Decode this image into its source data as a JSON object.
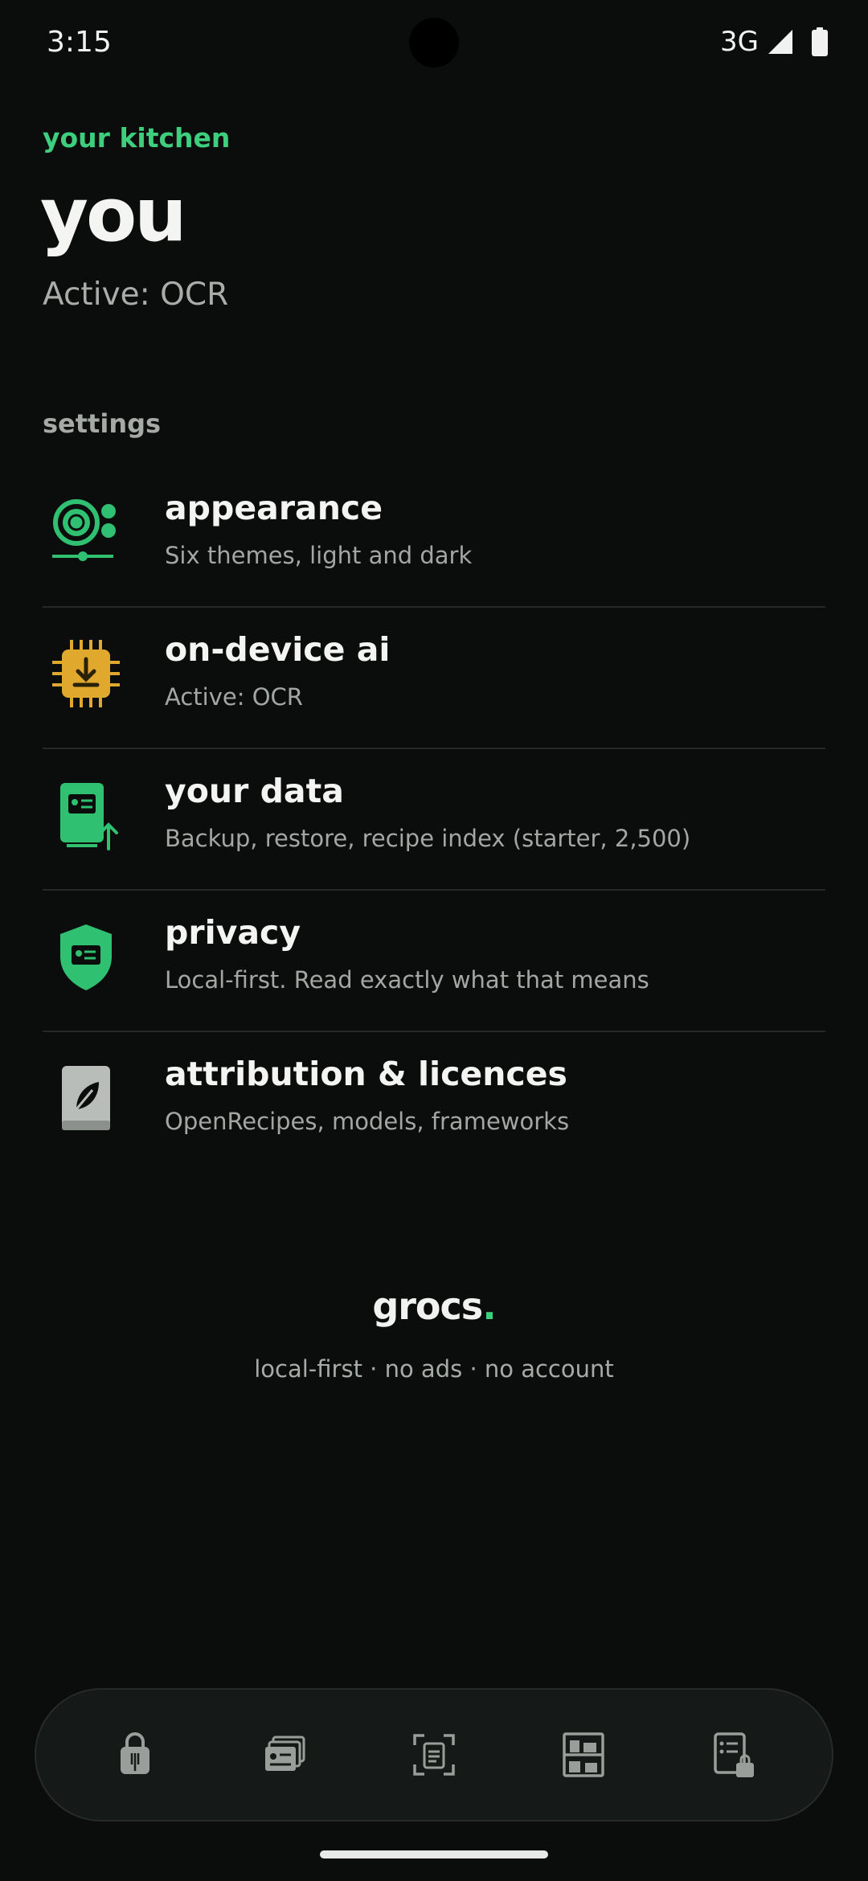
{
  "status_bar": {
    "time": "3:15",
    "network": "3G"
  },
  "header": {
    "kicker": "your kitchen",
    "title": "you",
    "active_status": "Active: OCR"
  },
  "settings": {
    "section_label": "settings",
    "items": [
      {
        "icon": "palette-icon",
        "title": "appearance",
        "subtitle": "Six themes, light and dark",
        "color": "#2fc071"
      },
      {
        "icon": "chip-download-icon",
        "title": "on-device ai",
        "subtitle": "Active: OCR",
        "color": "#e0a92e"
      },
      {
        "icon": "data-card-icon",
        "title": "your data",
        "subtitle": "Backup, restore, recipe index (starter, 2,500)",
        "color": "#2fc071"
      },
      {
        "icon": "shield-icon",
        "title": "privacy",
        "subtitle": "Local-first. Read exactly what that means",
        "color": "#2fc071"
      },
      {
        "icon": "book-leaf-icon",
        "title": "attribution & licences",
        "subtitle": "OpenRecipes, models, frameworks",
        "color": "#b9bdb9"
      }
    ]
  },
  "footer": {
    "brand": "grocs",
    "brand_dot": ".",
    "tagline": "local-first · no ads · no account"
  },
  "nav": {
    "items": [
      {
        "icon": "shopping-bag-icon"
      },
      {
        "icon": "recipe-cards-icon"
      },
      {
        "icon": "scan-icon"
      },
      {
        "icon": "pantry-shelf-icon"
      },
      {
        "icon": "list-bag-icon"
      }
    ]
  },
  "colors": {
    "accent": "#3ecf7e",
    "background": "#0b0d0c",
    "gold": "#e0a92e"
  }
}
